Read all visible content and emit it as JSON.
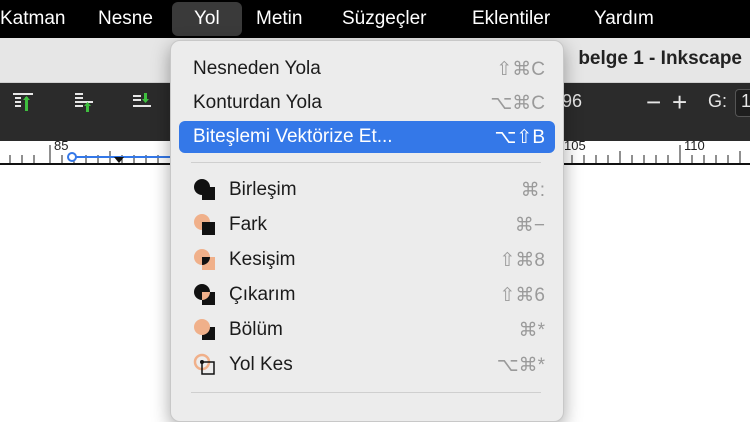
{
  "menubar": {
    "items": [
      "Katman",
      "Nesne",
      "Yol",
      "Metin",
      "Süzgeçler",
      "Eklentiler",
      "Yardım"
    ],
    "active_index": 2
  },
  "window": {
    "title": "belge 1 - Inkscape"
  },
  "toolbar": {
    "value_fragment": "96",
    "minus": "−",
    "plus": "+",
    "g_label": "G:",
    "g_fragment": "1"
  },
  "ruler": {
    "labels": [
      "85",
      "105",
      "110"
    ]
  },
  "menu": {
    "items": [
      {
        "label": "Nesneden Yola",
        "shortcut": "⇧⌘C",
        "icon": "none"
      },
      {
        "label": "Konturdan Yola",
        "shortcut": "⌥⌘C",
        "icon": "none"
      },
      {
        "label": "Biteşlemi Vektörize Et...",
        "shortcut": "⌥⇧B",
        "icon": "none",
        "highlighted": true
      },
      {
        "label": "Birleşim",
        "shortcut": "⌘:",
        "icon": "union-icon"
      },
      {
        "label": "Fark",
        "shortcut": "⌘−",
        "icon": "difference-icon"
      },
      {
        "label": "Kesişim",
        "shortcut": "⇧⌘8",
        "icon": "intersection-icon"
      },
      {
        "label": "Çıkarım",
        "shortcut": "⇧⌘6",
        "icon": "exclusion-icon"
      },
      {
        "label": "Bölüm",
        "shortcut": "⌘*",
        "icon": "division-icon"
      },
      {
        "label": "Yol Kes",
        "shortcut": "⌥⌘*",
        "icon": "cut-path-icon"
      }
    ]
  },
  "colors": {
    "highlight": "#3478e8",
    "shape_orange": "#f0b08a",
    "shape_black": "#111111"
  }
}
